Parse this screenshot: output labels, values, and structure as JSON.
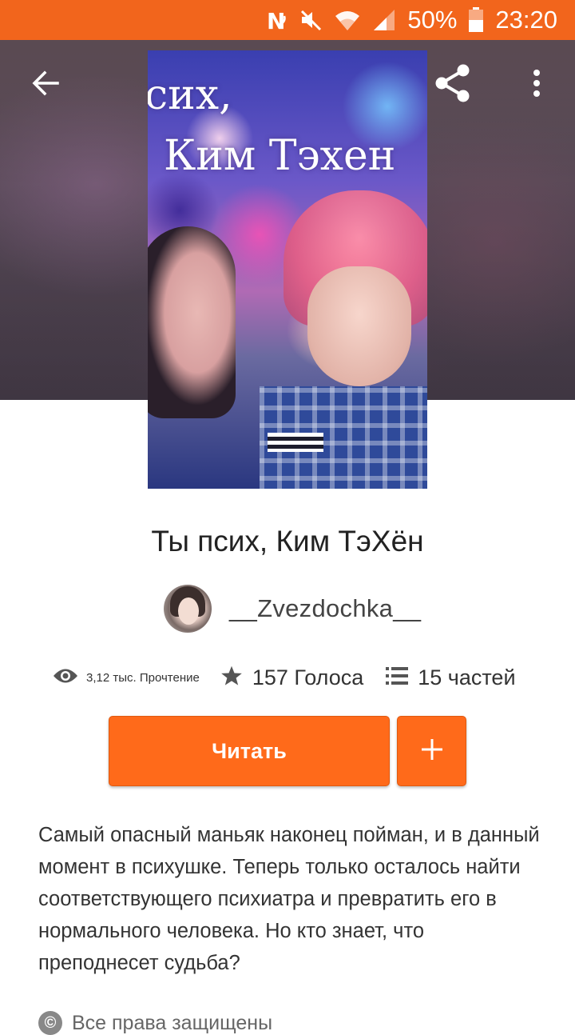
{
  "status_bar": {
    "battery": "50%",
    "time": "23:20",
    "icons": [
      "nfc-icon",
      "mute-icon",
      "wifi-icon",
      "signal-icon",
      "battery-icon"
    ]
  },
  "header": {
    "back_icon": "arrow-left-icon",
    "share_icon": "share-icon",
    "menu_icon": "more-vert-icon"
  },
  "cover": {
    "text_line1": "сих,",
    "text_line2": "Ким Тэхен"
  },
  "story": {
    "title": "Ты псих, Ким ТэХён",
    "author": "__Zvezdochka__",
    "reads": "3,12 тыс. Прочтение",
    "votes": "157 Голоса",
    "parts": "15 частей",
    "description": "Самый опасный маньяк наконец пойман, и в данный момент в психушке. Теперь только осталось найти соответствующего психиатра и превратить его в нормального человека. Но кто знает, что преподнесет судьба?",
    "rights": "Все права защищены"
  },
  "actions": {
    "read_label": "Читать",
    "add_icon": "plus-icon"
  },
  "colors": {
    "accent": "#ff6a1a",
    "status_bar": "#f2651c"
  }
}
